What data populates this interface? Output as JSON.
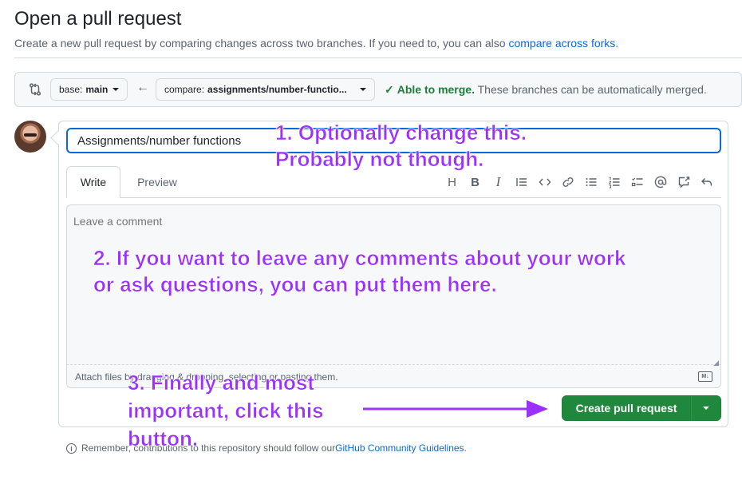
{
  "header": {
    "title": "Open a pull request",
    "subtitle_prefix": "Create a new pull request by comparing changes across two branches. If you need to, you can also ",
    "subtitle_link": "compare across forks",
    "subtitle_suffix": "."
  },
  "range": {
    "base_prefix": "base:",
    "base_branch": "main",
    "compare_prefix": "compare:",
    "compare_branch": "assignments/number-functio...",
    "merge_status": "Able to merge.",
    "merge_detail": " These branches can be automatically merged."
  },
  "form": {
    "title_value": "Assignments/number functions",
    "tabs": [
      "Write",
      "Preview"
    ],
    "toolbar_icons": [
      "heading-icon",
      "bold-icon",
      "italic-icon",
      "quote-icon",
      "code-icon",
      "link-icon",
      "unordered-list-icon",
      "ordered-list-icon",
      "task-list-icon",
      "mention-icon",
      "reference-icon",
      "undo-icon"
    ],
    "comment_placeholder": "Leave a comment",
    "attach_text": "Attach files by dragging & dropping, selecting or pasting them.",
    "markdown_badge": "M↓",
    "create_label": "Create pull request"
  },
  "footer": {
    "remember_prefix": "Remember, contributions to this repository should follow our ",
    "remember_link": "GitHub Community Guidelines",
    "remember_suffix": "."
  },
  "annotations": {
    "a1_line1": "1. Optionally change this.",
    "a1_line2": "Probably not though.",
    "a2_line1": "2. If you want to leave any comments about your work",
    "a2_line2": "or ask questions, you can put them here.",
    "a3_line1": "3. Finally and most",
    "a3_line2": "important, click this",
    "a3_line3": "button.",
    "color": "#9b30ff"
  },
  "colors": {
    "primary_button": "#1f883d",
    "link": "#0969da",
    "success": "#1a7f37",
    "focus_border": "#0969da"
  }
}
